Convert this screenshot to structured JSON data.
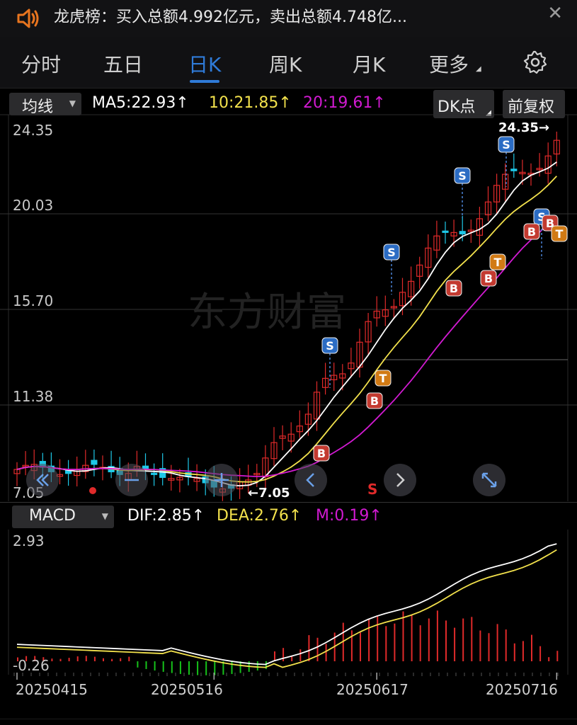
{
  "banner": {
    "message": "龙虎榜：买入总额4.992亿元，卖出总额4.748亿...",
    "close_symbol": "✕"
  },
  "tabs": [
    {
      "label": "分时",
      "active": false
    },
    {
      "label": "五日",
      "active": false
    },
    {
      "label": "日K",
      "active": true
    },
    {
      "label": "周K",
      "active": false
    },
    {
      "label": "月K",
      "active": false
    },
    {
      "label": "更多",
      "active": false
    }
  ],
  "settings_icon": "gear-icon",
  "ma_bar": {
    "selector_label": "均线",
    "ma5": "MA5:22.93↑",
    "ma10": "10:21.85↑",
    "ma20": "20:19.61↑",
    "dk_button": "DK点",
    "adjust_button": "前复权",
    "colors": {
      "ma5": "#ffffff",
      "ma10": "#f2e14c",
      "ma20": "#d11ad1"
    }
  },
  "price_axis": [
    "24.35",
    "20.03",
    "15.70",
    "11.38",
    "7.05"
  ],
  "annotations": {
    "high": "24.35→",
    "low": "←7.05",
    "watermark": "东方财富",
    "sell_marker": "S"
  },
  "signals": {
    "buy": "B",
    "sell": "S",
    "t": "T"
  },
  "macd_bar": {
    "selector_label": "MACD",
    "dif": "DIF:2.85↑",
    "dea": "DEA:2.76↑",
    "m": "M:0.19↑",
    "colors": {
      "dif": "#ffffff",
      "dea": "#f2e14c",
      "m": "#d11ad1"
    }
  },
  "macd_axis": [
    "2.93",
    "-0.26"
  ],
  "dates": [
    "20250415",
    "20250516",
    "20250617",
    "20250716"
  ],
  "colors": {
    "up": "#e02a2a",
    "down": "#1ec8e8",
    "accent": "#2f7bd8"
  }
}
